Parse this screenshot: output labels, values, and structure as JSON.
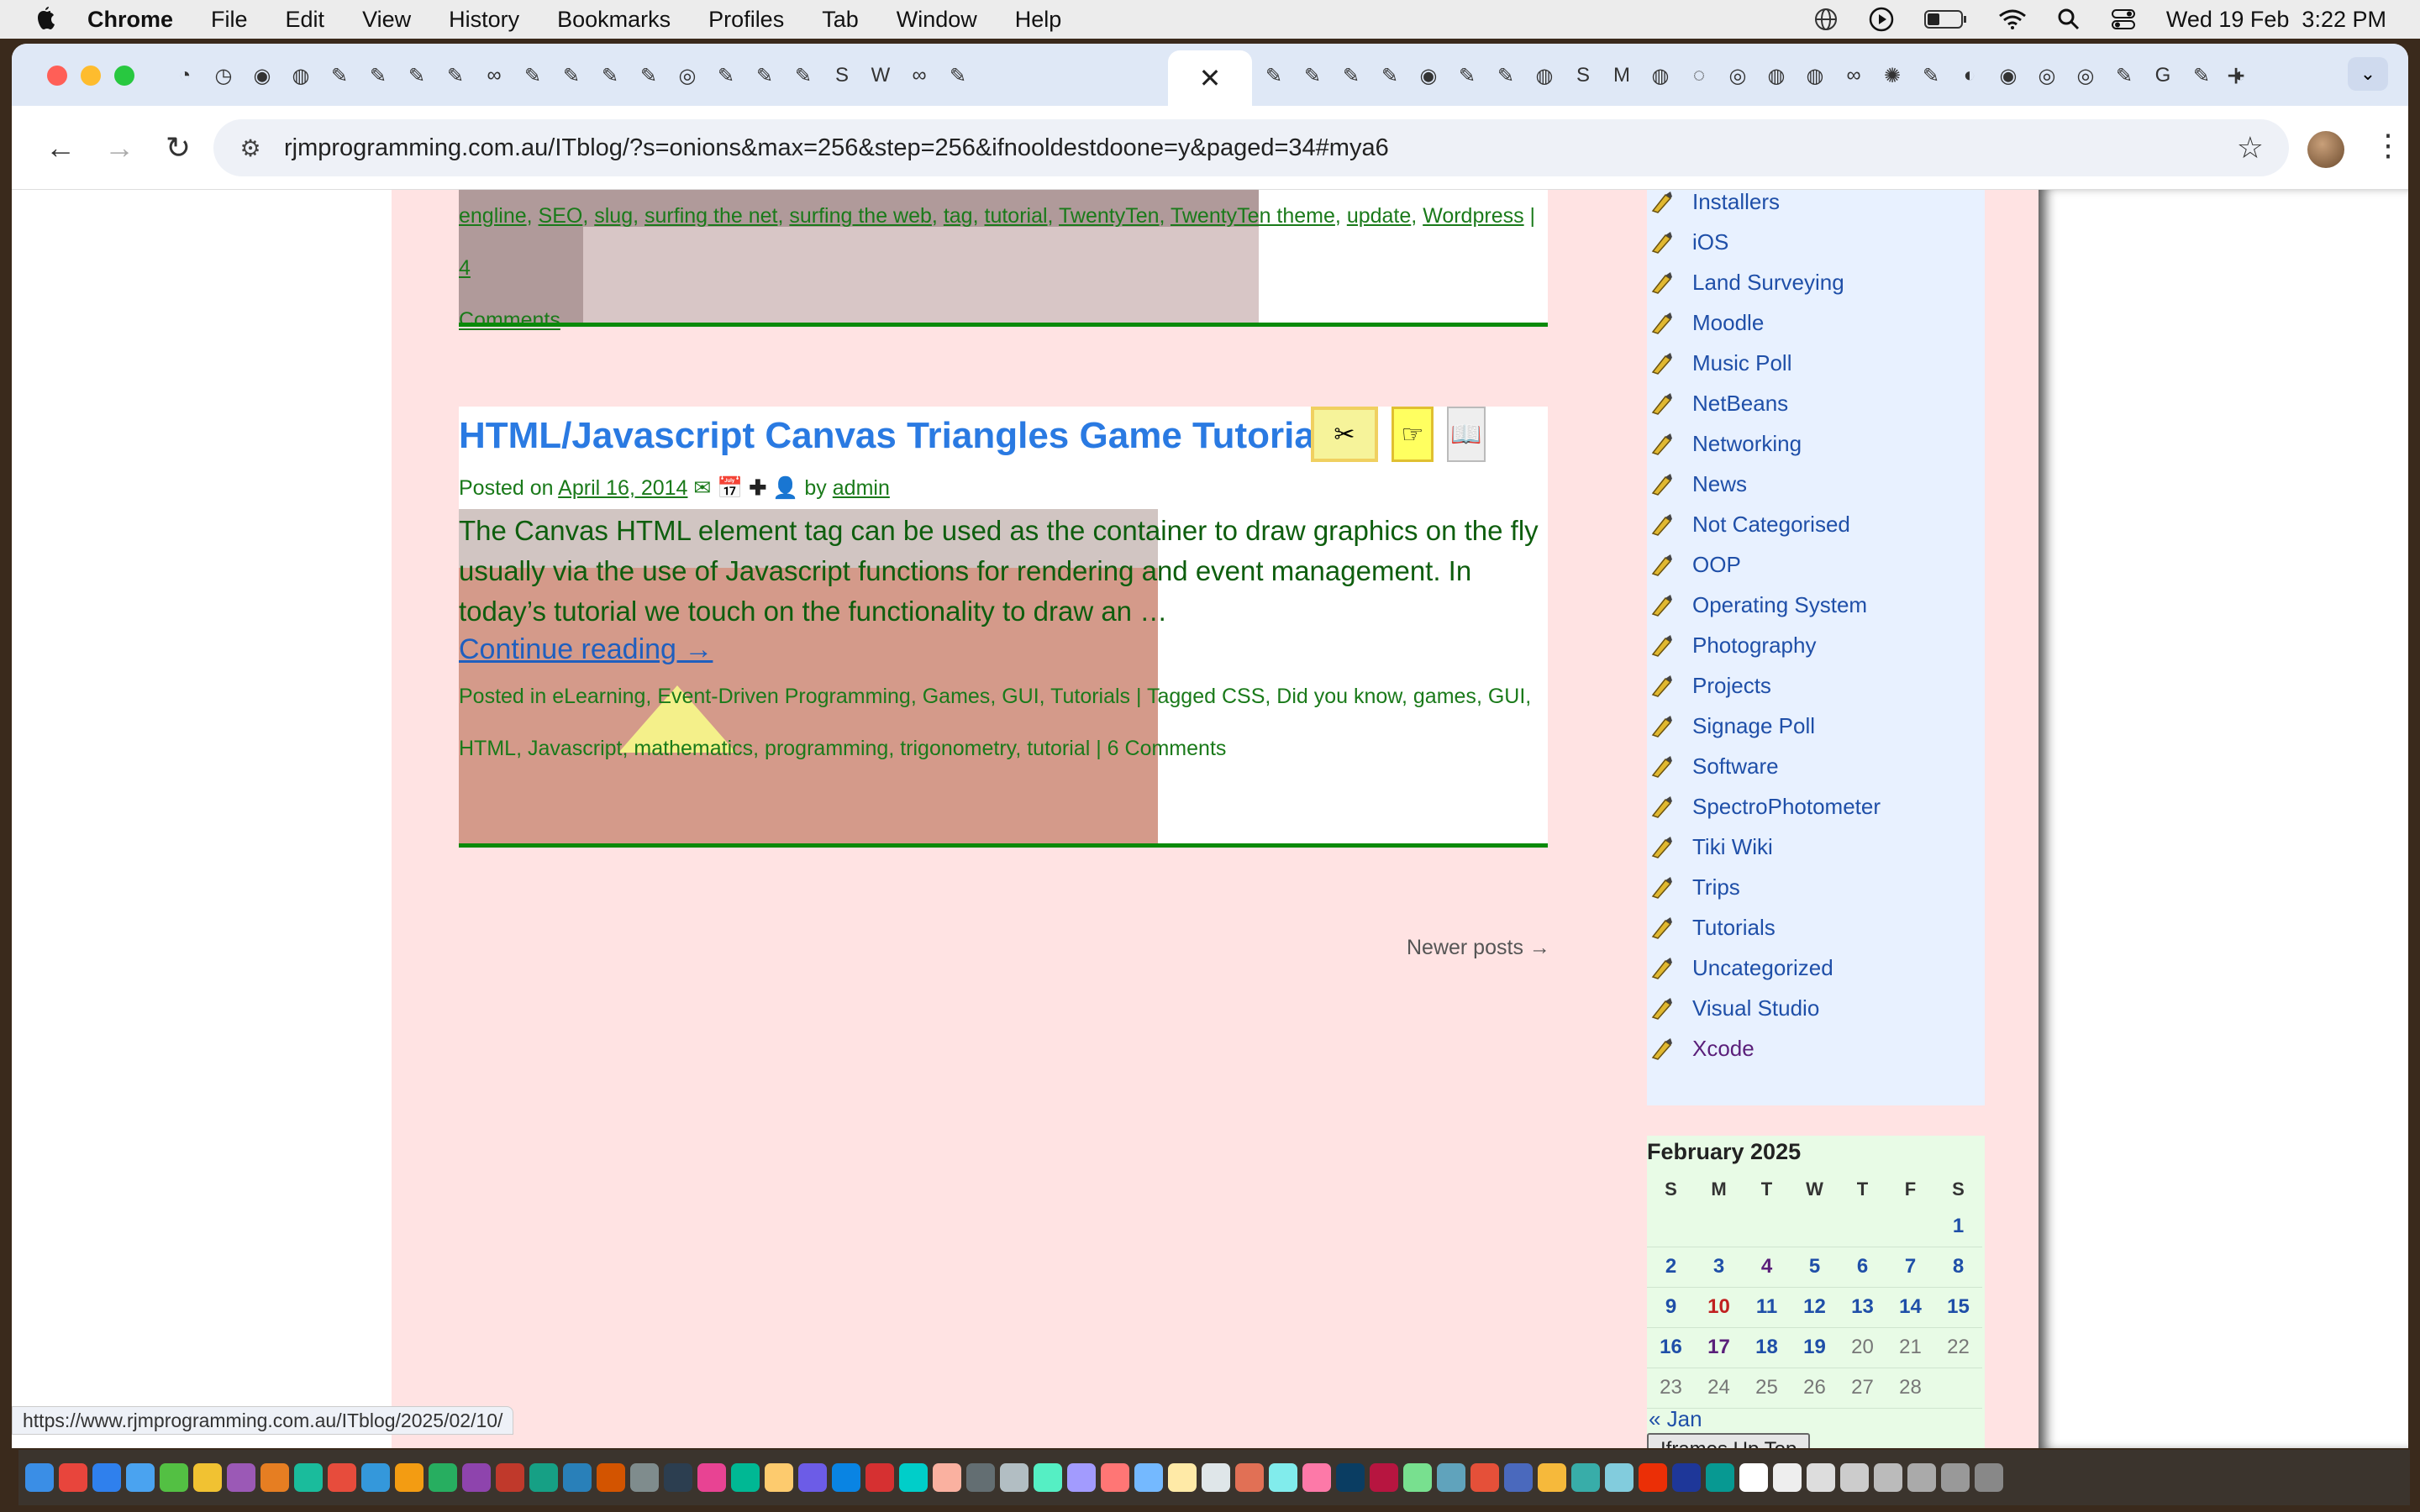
{
  "menubar": {
    "app": "Chrome",
    "items": [
      "File",
      "Edit",
      "View",
      "History",
      "Bookmarks",
      "Profiles",
      "Tab",
      "Window",
      "Help"
    ],
    "clock": "Wed 19 Feb  3:22 PM"
  },
  "browser": {
    "close_tab_glyph": "✕",
    "new_tab_glyph": "+",
    "url": "rjmprogramming.com.au/ITblog/?s=onions&max=256&step=256&ifnooldestdoone=y&paged=34#mya6",
    "status_url": "https://www.rjmprogramming.com.au/ITblog/2025/02/10/"
  },
  "prev_post": {
    "tag_line_1": [
      "engline",
      "SEO",
      "slug",
      "surfing the net",
      "surfing the web",
      "tag",
      "tutorial",
      "TwentyTen",
      "TwentyTen theme",
      "update",
      "Wordpress"
    ],
    "separator": "|",
    "comments_num": "4",
    "comments_word": "Comments"
  },
  "post": {
    "title": "HTML/Javascript Canvas Triangles Game Tutorial",
    "posted_on": "Posted on",
    "date": "April 16, 2014",
    "by": "by",
    "author": "admin",
    "excerpt": "The Canvas HTML element tag can be used as the container to draw graphics on the fly usually via the use of Javascript functions for rendering and event management. In today’s tutorial we touch on the functionality to draw an …",
    "continue": "Continue reading →",
    "posted_in": "Posted in",
    "categories": [
      "eLearning",
      "Event-Driven Programming",
      "Games",
      "GUI",
      "Tutorials"
    ],
    "tagged": "Tagged",
    "tags": [
      "CSS",
      "Did you know",
      "games",
      "GUI",
      "HTML",
      "Javascript",
      "mathematics",
      "programming",
      "trigonometry",
      "tutorial"
    ],
    "comments": "6 Comments"
  },
  "nav": {
    "newer": "Newer posts →"
  },
  "sidebar": {
    "categories": [
      "Installers",
      "iOS",
      "Land Surveying",
      "Moodle",
      "Music Poll",
      "NetBeans",
      "Networking",
      "News",
      "Not Categorised",
      "OOP",
      "Operating System",
      "Photography",
      "Projects",
      "Signage Poll",
      "Software",
      "SpectroPhotometer",
      "Tiki Wiki",
      "Trips",
      "Tutorials",
      "Uncategorized",
      "Visual Studio",
      "Xcode"
    ]
  },
  "calendar": {
    "caption": "February 2025",
    "weekdays": [
      "S",
      "M",
      "T",
      "W",
      "T",
      "F",
      "S"
    ],
    "rows": [
      [
        "",
        "",
        "",
        "",
        "",
        "",
        "1"
      ],
      [
        "2",
        "3",
        "4",
        "5",
        "6",
        "7",
        "8"
      ],
      [
        "9",
        "10",
        "11",
        "12",
        "13",
        "14",
        "15"
      ],
      [
        "16",
        "17",
        "18",
        "19",
        "20",
        "21",
        "22"
      ],
      [
        "23",
        "24",
        "25",
        "26",
        "27",
        "28",
        ""
      ]
    ],
    "prev": "« Jan",
    "button": "Iframes Up Top"
  }
}
